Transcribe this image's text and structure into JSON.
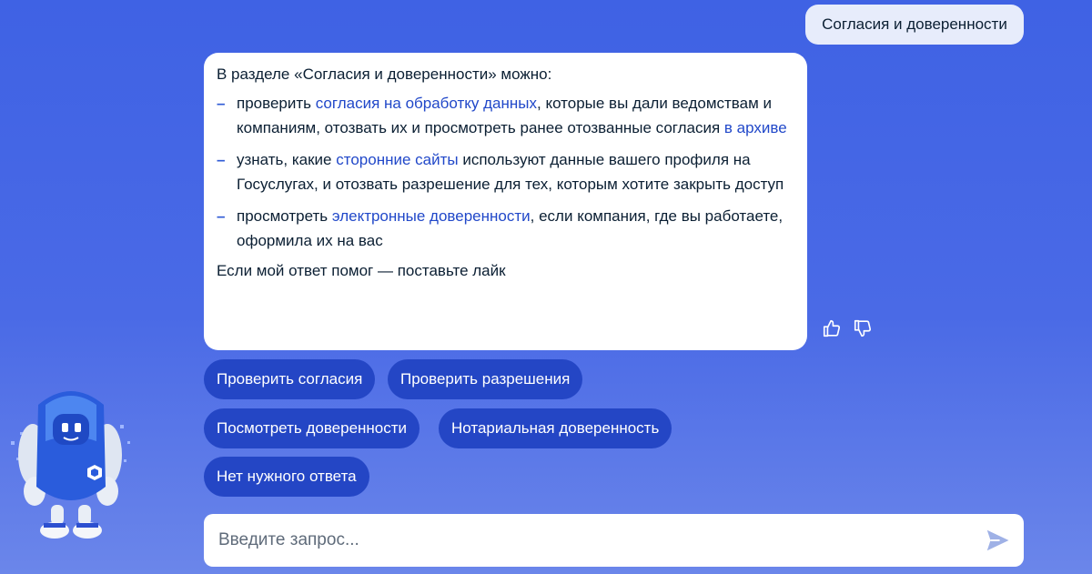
{
  "user_message": "Согласия и доверенности",
  "bot_message": {
    "intro": "В разделе «Согласия и доверенности» можно:",
    "items": [
      {
        "before": "проверить ",
        "link": "согласия на обработку данных",
        "middle": ", которые вы дали ведомствам и компаниям, отозвать их и просмотреть ранее отозванные согласия ",
        "link2": "в архиве",
        "after": ""
      },
      {
        "before": "узнать, какие ",
        "link": "сторонние сайты",
        "middle": " используют данные вашего профиля на Госуслугах, и отозвать разрешение для тех, которым хотите закрыть доступ",
        "link2": "",
        "after": ""
      },
      {
        "before": "просмотреть ",
        "link": "электронные доверенности",
        "middle": ", если компания, где вы работаете, оформила их на вас",
        "link2": "",
        "after": ""
      }
    ],
    "dash": "–",
    "outro": "Если мой ответ помог — поставьте лайк"
  },
  "feedback": {
    "like_icon": "thumbs-up-icon",
    "dislike_icon": "thumbs-down-icon"
  },
  "quick_replies": [
    "Проверить согласия",
    "Проверить разрешения",
    "Посмотреть доверенности",
    "Нотариальная доверенность",
    "Нет нужного ответа"
  ],
  "input": {
    "placeholder": "Введите запрос...",
    "value": ""
  },
  "send_icon": "send-icon",
  "colors": {
    "background": "#4a6ae6",
    "chip": "#2446c5",
    "link": "#2148c9",
    "user_bubble": "#e7ecfb"
  }
}
